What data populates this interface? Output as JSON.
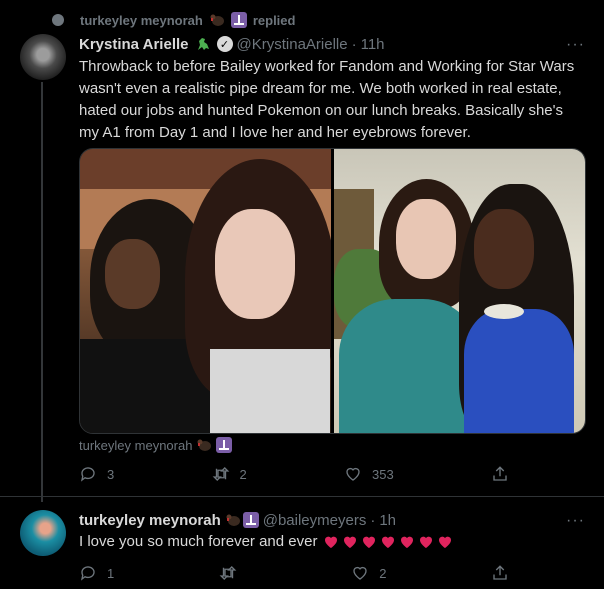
{
  "context": {
    "user": "turkeyley meynorah",
    "action": "replied"
  },
  "tweet1": {
    "name": "Krystina Arielle",
    "handle": "@KrystinaArielle",
    "separator": "·",
    "time": "11h",
    "more": "···",
    "text": "Throwback to before Bailey worked for Fandom and Working for Star Wars wasn't even a realistic pipe dream for me.  We both worked in real estate, hated our jobs and hunted Pokemon on our lunch breaks. Basically she's my A1 from Day 1 and I love her and her eyebrows forever.",
    "tagged": "turkeyley meynorah",
    "stats": {
      "replies": "3",
      "retweets": "2",
      "likes": "353"
    }
  },
  "tweet2": {
    "name": "turkeyley meynorah",
    "handle": "@baileymeyers",
    "separator": "·",
    "time": "1h",
    "more": "···",
    "text": "I love you so much forever and ever",
    "stats": {
      "replies": "1",
      "retweets": "",
      "likes": "2"
    }
  },
  "colors": {
    "background": "#000000",
    "text": "#d9d9d9",
    "muted": "#6e767d",
    "heart": "#e0245e",
    "menorah": "#7b5ea7"
  }
}
